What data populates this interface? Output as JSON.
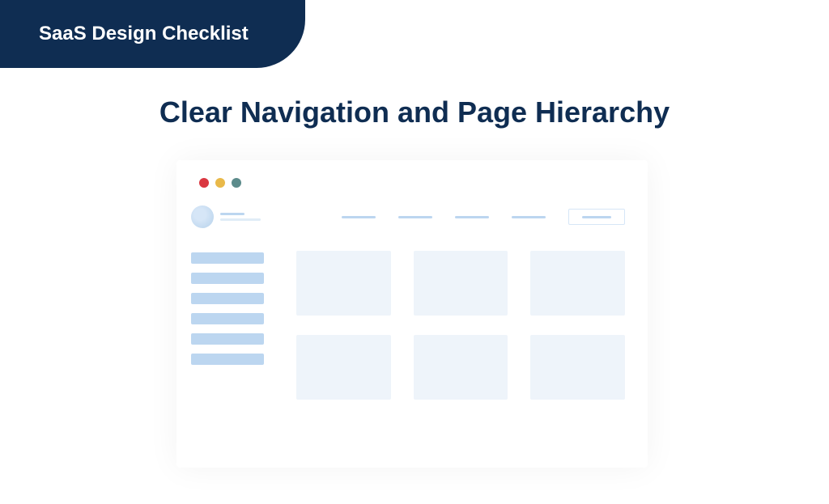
{
  "badge": {
    "label": "SaaS Design Checklist"
  },
  "heading": "Clear Navigation and Page Hierarchy",
  "mockup": {
    "window_dots": [
      "red",
      "yellow",
      "green"
    ],
    "sidebar": {
      "nav_item_count": 6
    },
    "top_nav": {
      "link_count": 4,
      "has_button": true
    },
    "card_grid": {
      "card_count": 6
    }
  }
}
